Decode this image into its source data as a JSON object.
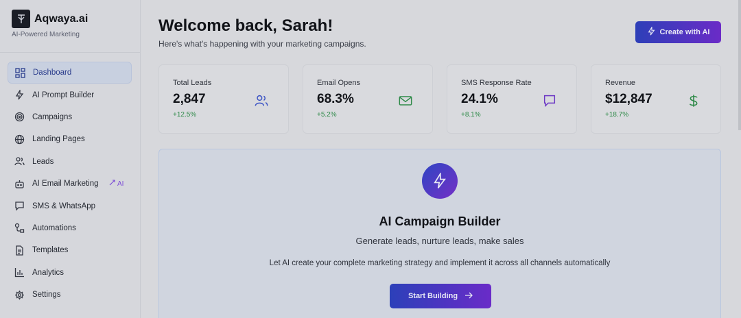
{
  "brand": {
    "name": "Aqwaya.ai",
    "tagline": "AI-Powered Marketing"
  },
  "sidebar": {
    "items": [
      {
        "label": "Dashboard",
        "icon": "grid-icon",
        "active": true
      },
      {
        "label": "AI Prompt Builder",
        "icon": "bolt-icon"
      },
      {
        "label": "Campaigns",
        "icon": "target-icon"
      },
      {
        "label": "Landing Pages",
        "icon": "globe-icon"
      },
      {
        "label": "Leads",
        "icon": "users-icon"
      },
      {
        "label": "AI Email Marketing",
        "icon": "bot-icon",
        "badge": "AI"
      },
      {
        "label": "SMS & WhatsApp",
        "icon": "chat-icon"
      },
      {
        "label": "Automations",
        "icon": "workflow-icon"
      },
      {
        "label": "Templates",
        "icon": "file-icon"
      },
      {
        "label": "Analytics",
        "icon": "bar-chart-icon"
      },
      {
        "label": "Settings",
        "icon": "gear-icon"
      }
    ]
  },
  "header": {
    "title": "Welcome back, Sarah!",
    "subtitle": "Here's what's happening with your marketing campaigns.",
    "cta_label": "Create with AI"
  },
  "stats": [
    {
      "label": "Total Leads",
      "value": "2,847",
      "change": "+12.5%",
      "icon": "users-icon",
      "color": "#3a52c4"
    },
    {
      "label": "Email Opens",
      "value": "68.3%",
      "change": "+5.2%",
      "icon": "mail-icon",
      "color": "#2f8a49"
    },
    {
      "label": "SMS Response Rate",
      "value": "24.1%",
      "change": "+8.1%",
      "icon": "message-icon",
      "color": "#6b36c4"
    },
    {
      "label": "Revenue",
      "value": "$12,847",
      "change": "+18.7%",
      "icon": "dollar-icon",
      "color": "#2f8a49"
    }
  ],
  "builder": {
    "title": "AI Campaign Builder",
    "subtitle": "Generate leads, nurture leads, make sales",
    "description": "Let AI create your complete marketing strategy and implement it across all channels automatically",
    "button_label": "Start Building"
  }
}
